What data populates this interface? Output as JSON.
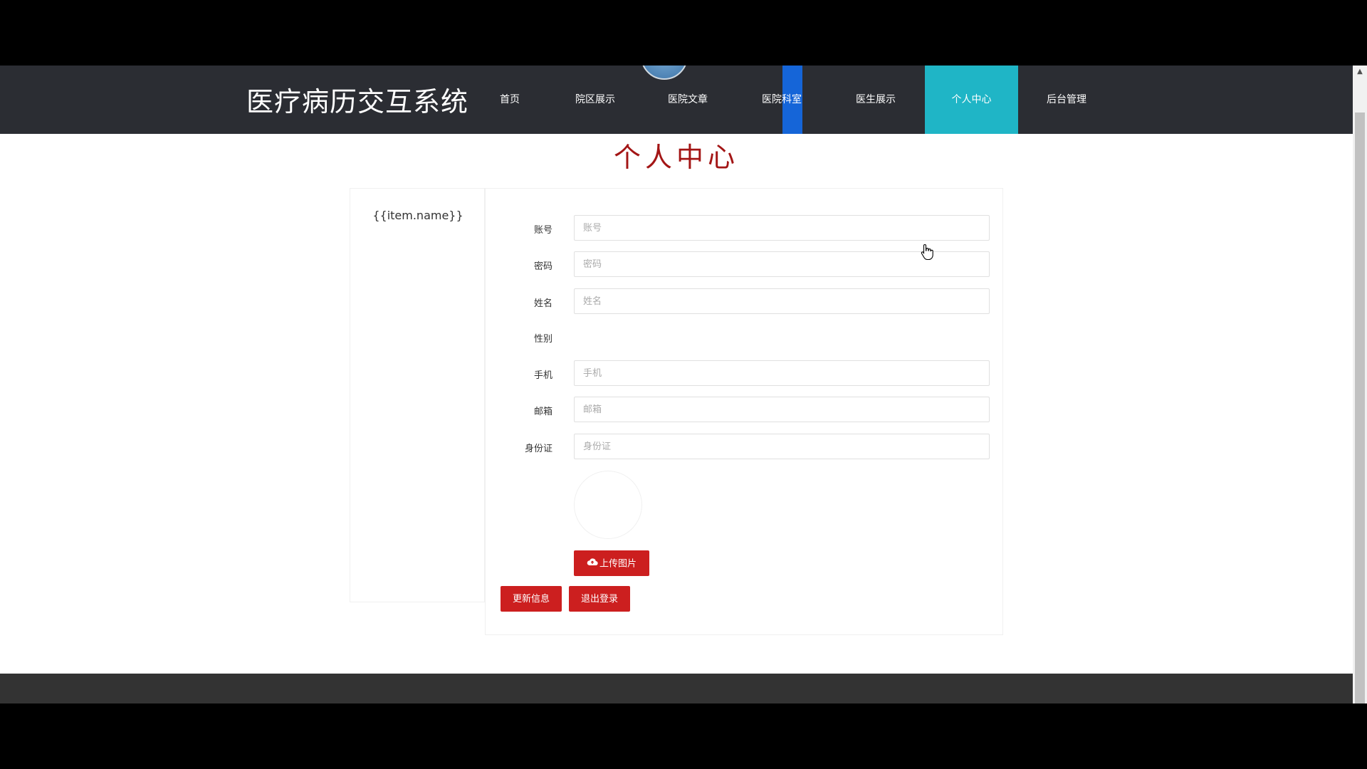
{
  "header": {
    "title": "医疗病历交互系统",
    "nav": [
      {
        "label": "首页"
      },
      {
        "label": "院区展示"
      },
      {
        "label": "医院文章"
      },
      {
        "label": "医院科室"
      },
      {
        "label": "医生展示"
      },
      {
        "label": "个人中心"
      },
      {
        "label": "后台管理"
      }
    ],
    "active_nav": "个人中心",
    "active_color": "#1fb5c6"
  },
  "page": {
    "title": "个人中心"
  },
  "sidebar": {
    "item": "{{item.name}}"
  },
  "form": {
    "fields": [
      {
        "label": "账号",
        "placeholder": "账号",
        "value": ""
      },
      {
        "label": "密码",
        "placeholder": "密码",
        "value": ""
      },
      {
        "label": "姓名",
        "placeholder": "姓名",
        "value": ""
      },
      {
        "label": "性别"
      },
      {
        "label": "手机",
        "placeholder": "手机",
        "value": ""
      },
      {
        "label": "邮箱",
        "placeholder": "邮箱",
        "value": ""
      },
      {
        "label": "身份证",
        "placeholder": "身份证",
        "value": ""
      }
    ],
    "upload_label": "上传图片",
    "update_label": "更新信息",
    "logout_label": "退出登录",
    "button_color": "#cc1f1f"
  },
  "icons": {
    "upload": "cloud-upload-icon",
    "cursor": "hand-pointer-icon"
  }
}
